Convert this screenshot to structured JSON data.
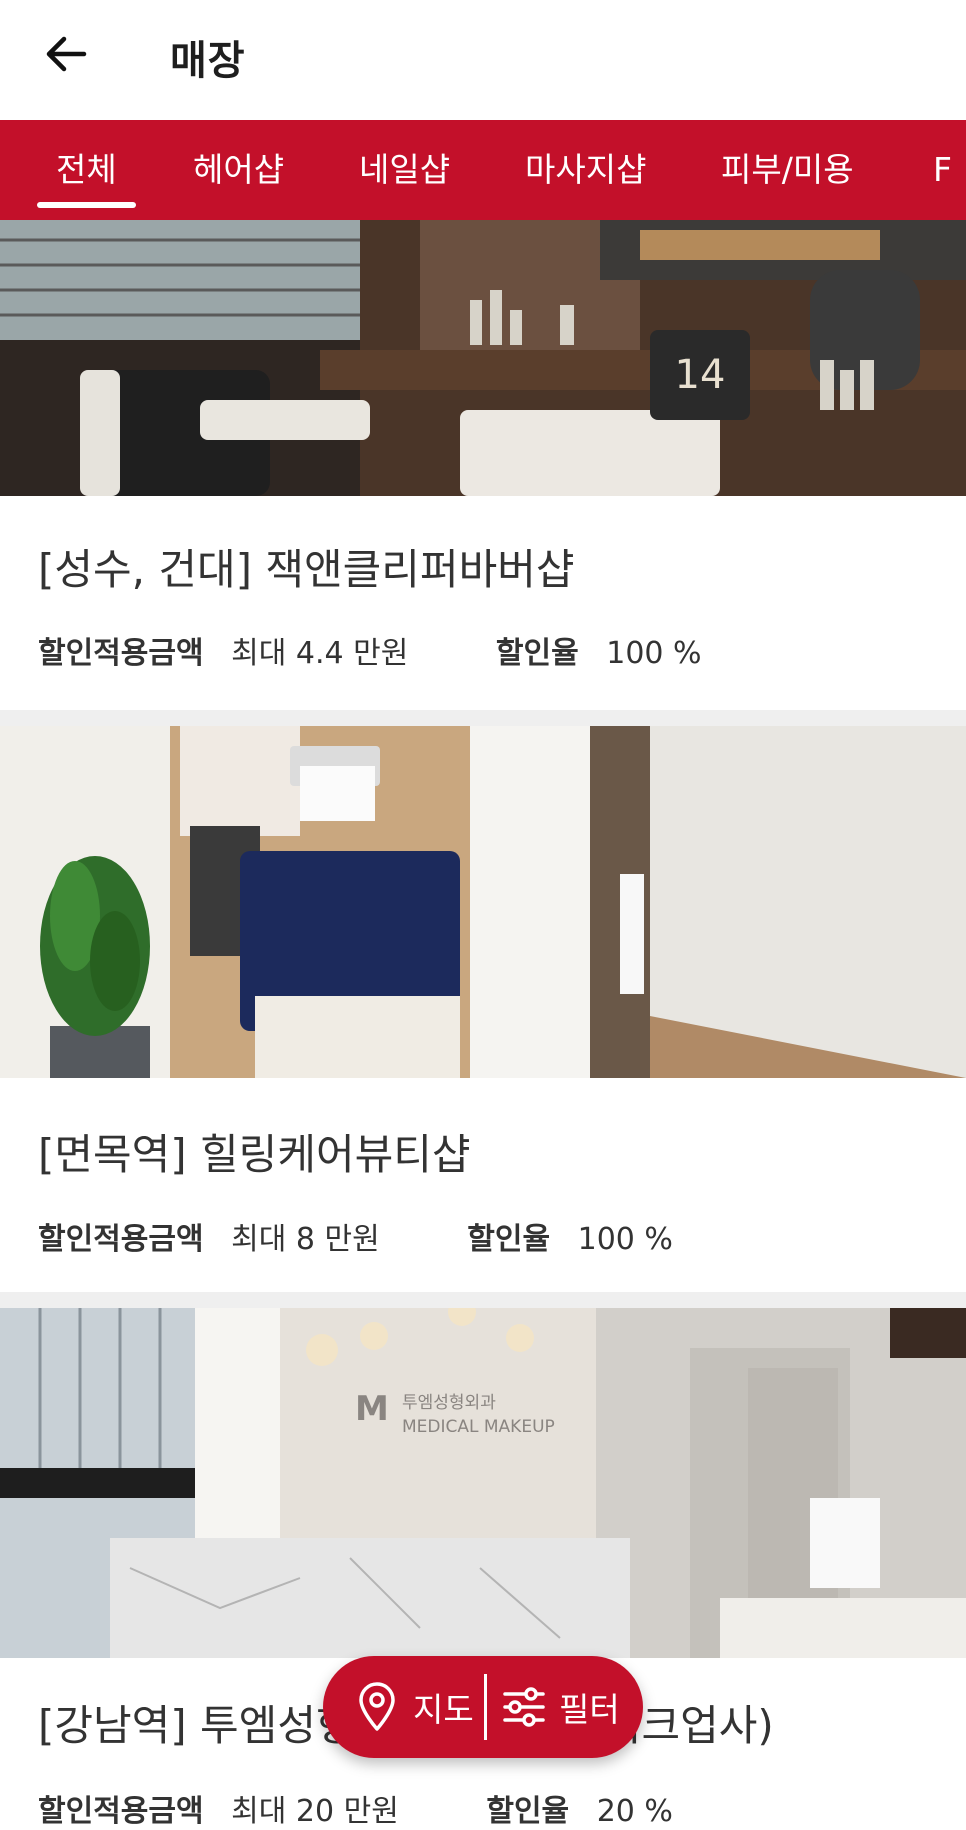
{
  "header": {
    "title": "매장",
    "back_icon": "arrow-left-icon"
  },
  "tabs": [
    {
      "label": "전체",
      "active": true
    },
    {
      "label": "헤어샵",
      "active": false
    },
    {
      "label": "네일샵",
      "active": false
    },
    {
      "label": "마사지샵",
      "active": false
    },
    {
      "label": "피부/미용",
      "active": false
    },
    {
      "label": "F",
      "active": false
    }
  ],
  "stores": [
    {
      "name": "[성수, 건대] 잭앤클리퍼바버샵",
      "amount_label": "할인적용금액",
      "amount_value": "최대 4.4 만원",
      "rate_label": "할인율",
      "rate_value": "100 %",
      "image": "barbershop-interior"
    },
    {
      "name": "[면목역] 힐링케어뷰티샵",
      "amount_label": "할인적용금액",
      "amount_value": "최대 8 만원",
      "rate_label": "할인율",
      "rate_value": "100 %",
      "image": "beauty-treatment-room"
    },
    {
      "name": "[강남역] 투엠성형외과(메디컬메이크업사)",
      "amount_label": "할인적용금액",
      "amount_value": "최대 20 만원",
      "rate_label": "할인율",
      "rate_value": "20 %",
      "image": "clinic-reception",
      "image_sign_kr": "투엠성형외과",
      "image_sign_en": "MEDICAL MAKEUP"
    }
  ],
  "fab": {
    "map_label": "지도",
    "map_icon": "map-pin-icon",
    "filter_label": "필터",
    "filter_icon": "sliders-icon"
  },
  "colors": {
    "brand": "#c3102a",
    "separator": "#efefef"
  }
}
